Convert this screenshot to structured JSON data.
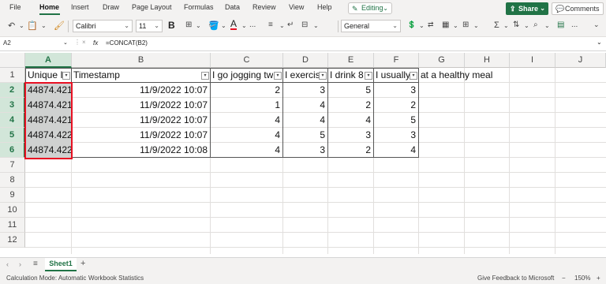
{
  "menu": {
    "items": [
      "File",
      "Home",
      "Insert",
      "Draw",
      "Page Layout",
      "Formulas",
      "Data",
      "Review",
      "View",
      "Help"
    ],
    "editing_label": "Editing",
    "share_label": "Share",
    "comments_label": "Comments"
  },
  "ribbon": {
    "font_name": "Calibri",
    "font_size": "11",
    "number_format": "General",
    "bold_label": "B",
    "ellipsis": "..."
  },
  "formula_bar": {
    "cell_ref": "A2",
    "fx_label": "fx",
    "formula": "=CONCAT(B2)"
  },
  "grid": {
    "columns": [
      "A",
      "B",
      "C",
      "D",
      "E",
      "F",
      "G",
      "H",
      "I",
      "J"
    ],
    "rows": [
      "1",
      "2",
      "3",
      "4",
      "5",
      "6",
      "7",
      "8",
      "9",
      "10",
      "11",
      "12"
    ],
    "headers": [
      "Unique I",
      "Timestamp",
      "I go jogging tw",
      "I exercis",
      "I drink 8",
      "I usually",
      "at a healthy meal"
    ],
    "data": [
      [
        "44874.421",
        "11/9/2022 10:07",
        "2",
        "3",
        "5",
        "3"
      ],
      [
        "44874.421",
        "11/9/2022 10:07",
        "1",
        "4",
        "2",
        "2"
      ],
      [
        "44874.421",
        "11/9/2022 10:07",
        "4",
        "4",
        "4",
        "5"
      ],
      [
        "44874.422",
        "11/9/2022 10:07",
        "4",
        "5",
        "3",
        "3"
      ],
      [
        "44874.422",
        "11/9/2022 10:08",
        "4",
        "3",
        "2",
        "4"
      ]
    ]
  },
  "sheet_tabs": {
    "active": "Sheet1",
    "add_label": "+"
  },
  "status_bar": {
    "calc_mode": "Calculation Mode: Automatic",
    "workbook_stats": "Workbook Statistics",
    "feedback": "Give Feedback to Microsoft",
    "zoom": "150%"
  },
  "colors": {
    "accent": "#217346",
    "selection_border": "#e81123"
  }
}
